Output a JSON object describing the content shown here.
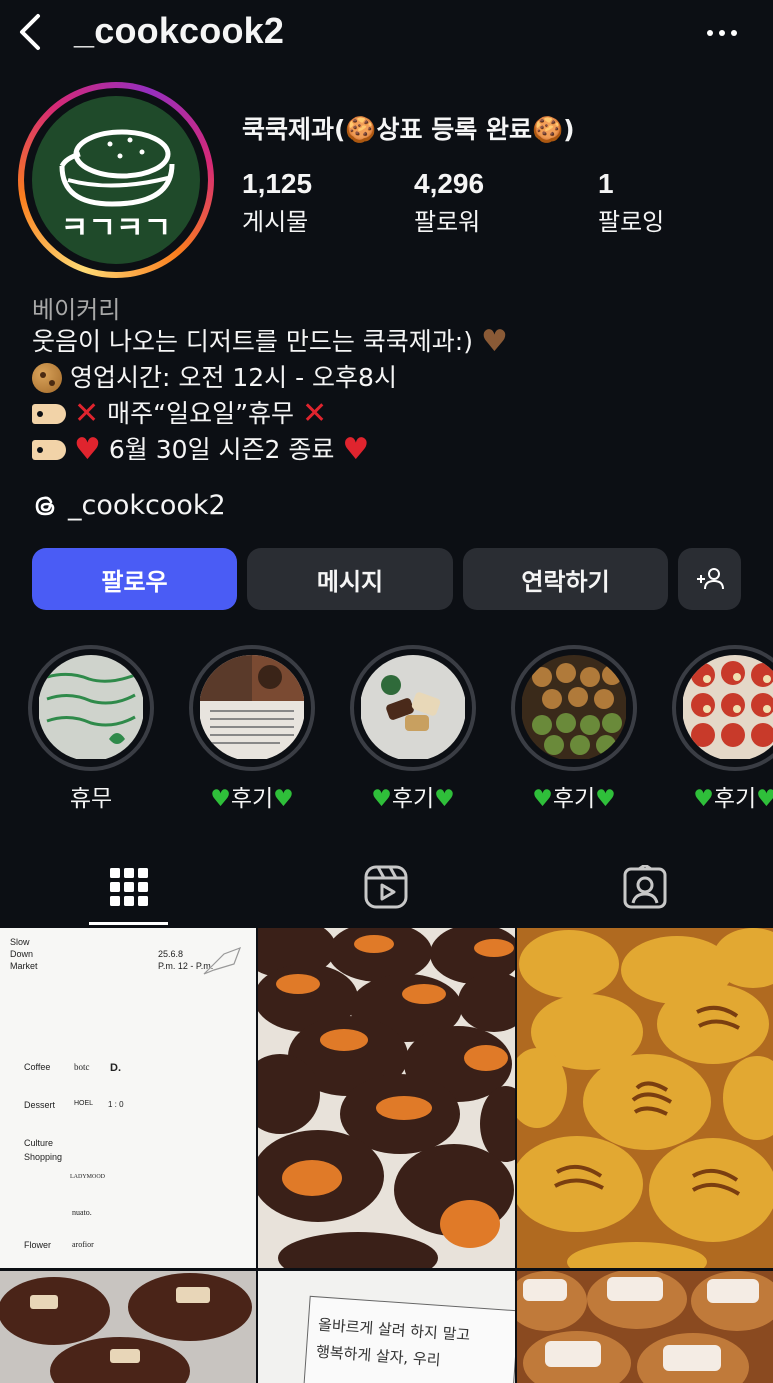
{
  "header": {
    "username": "_cookcook2"
  },
  "profile": {
    "display_name": "쿡쿡제과(🍪상표 등록 완료🍪)",
    "stats": [
      {
        "value": "1,125",
        "label": "게시물"
      },
      {
        "value": "4,296",
        "label": "팔로워"
      },
      {
        "value": "1",
        "label": "팔로잉"
      }
    ],
    "category": "베이커리",
    "bio": {
      "line1": "웃음이 나오는 디저트를 만드는 쿡쿡제과:)",
      "line2": "영업시간: 오전 12시 - 오후8시",
      "line3": "매주“일요일”휴무",
      "line4": "6월 30일 시즌2 종료"
    },
    "threads_handle": "_cookcook2",
    "avatar_text": "ㅋㄱㅋㄱ"
  },
  "actions": {
    "follow": "팔로우",
    "message": "메시지",
    "contact": "연락하기"
  },
  "highlights": [
    {
      "label": "휴무",
      "image": "handwritten-note"
    },
    {
      "label": "후기",
      "image": "review-collage"
    },
    {
      "label": "후기",
      "image": "dessert-plate"
    },
    {
      "label": "후기",
      "image": "cookie-tray"
    },
    {
      "label": "후기",
      "image": "dessert-cups"
    }
  ],
  "highlights_icon": "green-heart-icon",
  "tabs": [
    "grid-icon",
    "reels-icon",
    "tagged-icon"
  ],
  "posts": {
    "poster": {
      "title_lines": [
        "Slow",
        "Down",
        "Market"
      ],
      "date": "25.6.8",
      "time": "P.m. 12 - P.m.",
      "sections": [
        "Coffee",
        "Dessert",
        "Culture\nShopping",
        "Flower"
      ],
      "brands": [
        "botc",
        "D.",
        "HOEL",
        "1 : 0",
        "LADYMOOD",
        "nuato.",
        "arofior"
      ]
    },
    "note_text_1": "올바르게 살려 하지 말고",
    "note_text_2": "행복하게 살자, 우리"
  },
  "colors": {
    "background": "#0c0f14",
    "follow_button": "#4a5cf5",
    "secondary_button": "#2a2d33",
    "muted_text": "#a8a8a8",
    "green_heart": "#2fbf3a",
    "red": "#e0242e"
  }
}
